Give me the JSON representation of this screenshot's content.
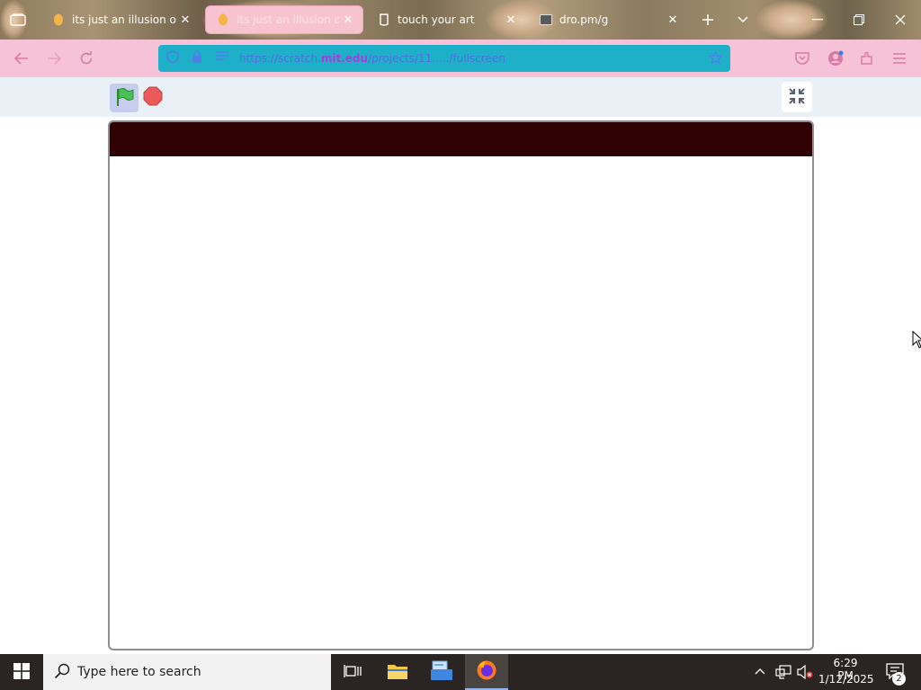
{
  "browser": {
    "tabs": [
      {
        "title": "its just an illusion on Sc",
        "icon": "scratch-icon",
        "active": false
      },
      {
        "title": "its just an illusion on Sc",
        "icon": "scratch-icon",
        "active": true
      },
      {
        "title": "touch your art",
        "icon": "mug-icon",
        "active": false
      },
      {
        "title": "dro.pm/g",
        "icon": "dropbox-icon",
        "active": false
      }
    ],
    "close_glyph": "✕",
    "url": {
      "prefix": "https://scratch.",
      "domain": "mit.edu",
      "path": "/projects/11...../fullscreen"
    },
    "accent_color": "#f6c2d7",
    "url_bar_color": "#1fb0c9"
  },
  "project": {
    "stage_top_color": "#2f0103"
  },
  "taskbar": {
    "search_placeholder": "Type here to search",
    "time": "6:29 PM",
    "date": "1/12/2025",
    "notification_count": "2"
  }
}
